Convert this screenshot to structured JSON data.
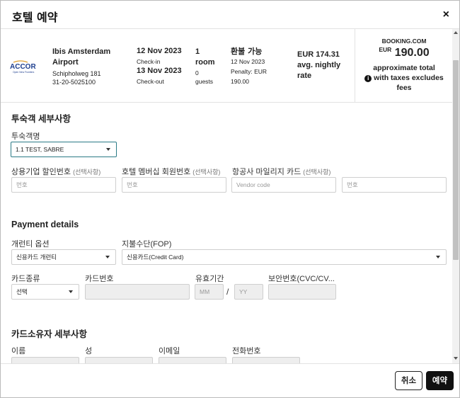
{
  "dialog": {
    "title": "호텔 예약",
    "close_label": "×"
  },
  "summary": {
    "logo": {
      "brand": "ACCOR",
      "tagline": "Open New Frontiers"
    },
    "hotel_name": "Ibis Amsterdam Airport",
    "address_line1": "Schipholweg 181",
    "address_line2": "31-20-5025100",
    "checkin_date": "12 Nov 2023",
    "checkin_label": "Check-in",
    "checkout_date": "13 Nov 2023",
    "checkout_label": "Check-out",
    "rooms_count": "1",
    "rooms_label": "room",
    "guests_count": "0",
    "guests_label": "guests",
    "refund_title": "환불 가능",
    "refund_detail_date": "12 Nov 2023",
    "refund_detail_penalty": "Penalty: EUR 190.00",
    "rate": "EUR 174.31 avg. nightly rate",
    "total_source": "BOOKING.COM",
    "total_currency": "EUR",
    "total_amount": "190.00",
    "total_note": "approximate total",
    "total_tax_note": "with taxes excludes fees",
    "info_icon_glyph": "i"
  },
  "guest_section": {
    "title": "투숙객 세부사항",
    "guest_name_label": "투숙객명",
    "guest_name_value": "1.1 TEST, SABRE",
    "corp_discount_label": "상용기업 할인번호",
    "hotel_member_label": "호텔 멤버십 회원번호",
    "airline_mileage_label": "항공사 마일리지 카드",
    "optional_tag": "(선택사항)",
    "number_placeholder": "번호",
    "vendor_code_placeholder": "Vendor code"
  },
  "payment_section": {
    "title": "Payment details",
    "guarantee_label": "개런티 옵션",
    "guarantee_value": "신용카드 개런티",
    "fop_label": "지불수단(FOP)",
    "fop_value": "신용카드(Credit Card)",
    "card_type_label": "카드종류",
    "card_type_value": "선택",
    "card_number_label": "카드번호",
    "expiry_label": "유효기간",
    "expiry_month_placeholder": "MM",
    "expiry_separator": "/",
    "expiry_year_placeholder": "YY",
    "cvc_label": "보안번호(CVC/CV..."
  },
  "cardholder_section": {
    "title": "카드소유자 세부사항",
    "first_name_label": "이름",
    "last_name_label": "성",
    "email_label": "이메일",
    "phone_label": "전화번호"
  },
  "footer": {
    "cancel_label": "취소",
    "reserve_label": "예약"
  },
  "colors": {
    "focus_border": "#2a7a86",
    "primary_button": "#111111",
    "accor_blue": "#1e3f8f"
  }
}
